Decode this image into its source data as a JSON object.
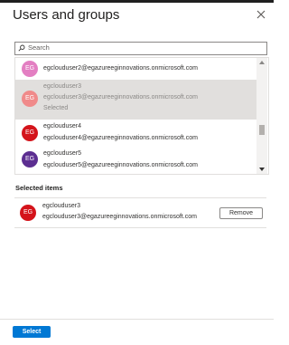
{
  "panel": {
    "title": "Users and groups",
    "search_placeholder": "Search",
    "selected_section_title": "Selected items",
    "select_label": "Select",
    "remove_label": "Remove"
  },
  "users": [
    {
      "initials": "EG",
      "name": "",
      "email": "egclouduser2@egazureeginnovations.onmicrosoft.com",
      "status": "",
      "color": "#e37fc2"
    },
    {
      "initials": "EG",
      "name": "egclouduser3",
      "email": "egclouduser3@egazureeginnovations.onmicrosoft.com",
      "status": "Selected",
      "color": "#f08a8a"
    },
    {
      "initials": "EG",
      "name": "egclouduser4",
      "email": "egclouduser4@egazureeginnovations.onmicrosoft.com",
      "status": "",
      "color": "#d4141b"
    },
    {
      "initials": "EG",
      "name": "egclouduser5",
      "email": "egclouduser5@egazureeginnovations.onmicrosoft.com",
      "status": "",
      "color": "#5c2e91"
    }
  ],
  "selected_items": [
    {
      "initials": "EG",
      "name": "egclouduser3",
      "email": "egclouduser3@egazureeginnovations.onmicrosoft.com",
      "color": "#d4141b"
    }
  ]
}
